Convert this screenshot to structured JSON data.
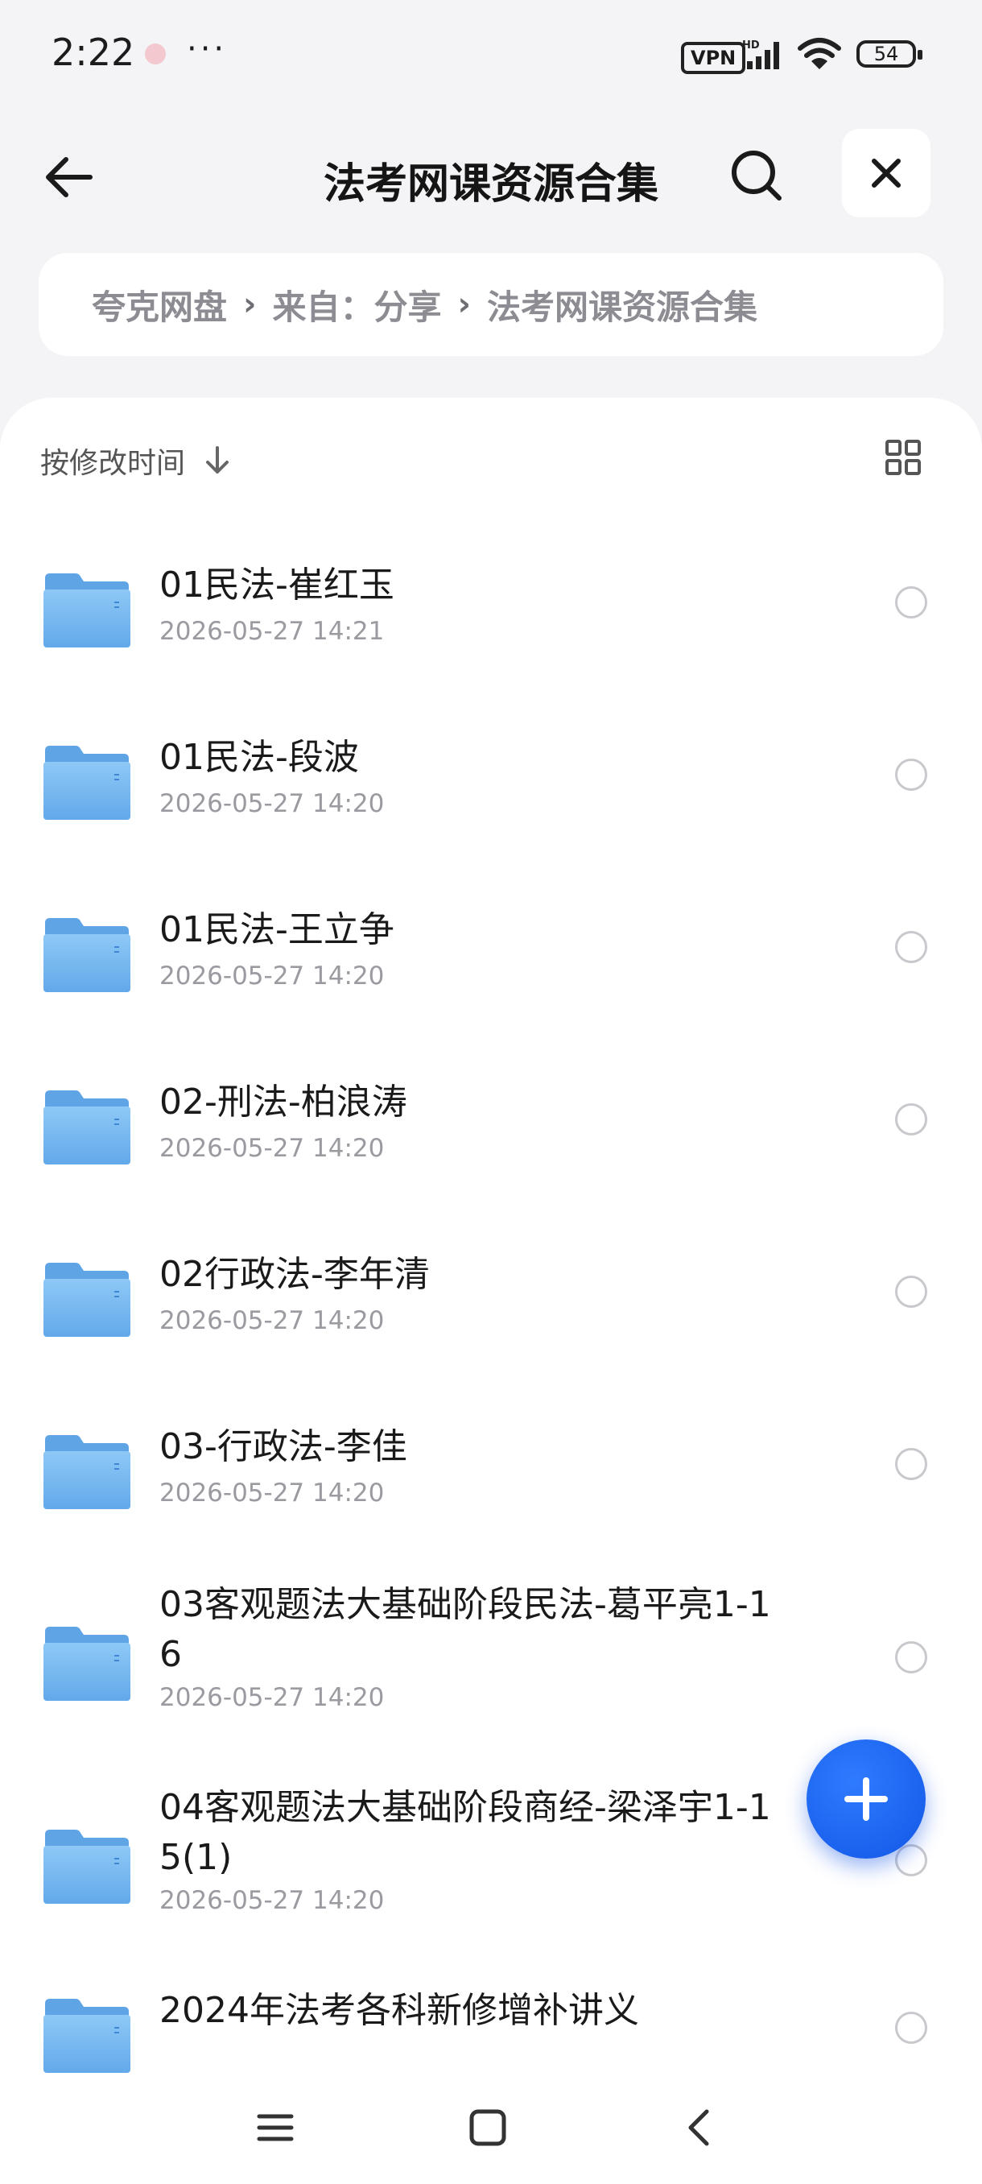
{
  "status_bar": {
    "time": "2:22",
    "more": "···",
    "vpn_label": "VPN",
    "battery": "54"
  },
  "header": {
    "title": "法考网课资源合集"
  },
  "breadcrumb": {
    "items": [
      "夸克网盘",
      "来自：分享",
      "法考网课资源合集"
    ]
  },
  "toolbar": {
    "sort_label": "按修改时间"
  },
  "files": [
    {
      "name": "01民法-崔红玉",
      "date": "2026-05-27 14:21"
    },
    {
      "name": "01民法-段波",
      "date": "2026-05-27 14:20"
    },
    {
      "name": "01民法-王立争",
      "date": "2026-05-27 14:20"
    },
    {
      "name": "02-刑法-柏浪涛",
      "date": "2026-05-27 14:20"
    },
    {
      "name": "02行政法-李年清",
      "date": "2026-05-27 14:20"
    },
    {
      "name": "03-行政法-李佳",
      "date": "2026-05-27 14:20"
    },
    {
      "name": "03客观题法大基础阶段民法-葛平亮1-16",
      "date": "2026-05-27 14:20"
    },
    {
      "name": "04客观题法大基础阶段商经-梁泽宇1-15(1)",
      "date": "2026-05-27 14:20"
    },
    {
      "name": "2024年法考各科新修增补讲义",
      "date": ""
    }
  ],
  "colors": {
    "accent": "#1a63f0",
    "folder": "#7ab8f0",
    "background": "#f4f4f6"
  }
}
